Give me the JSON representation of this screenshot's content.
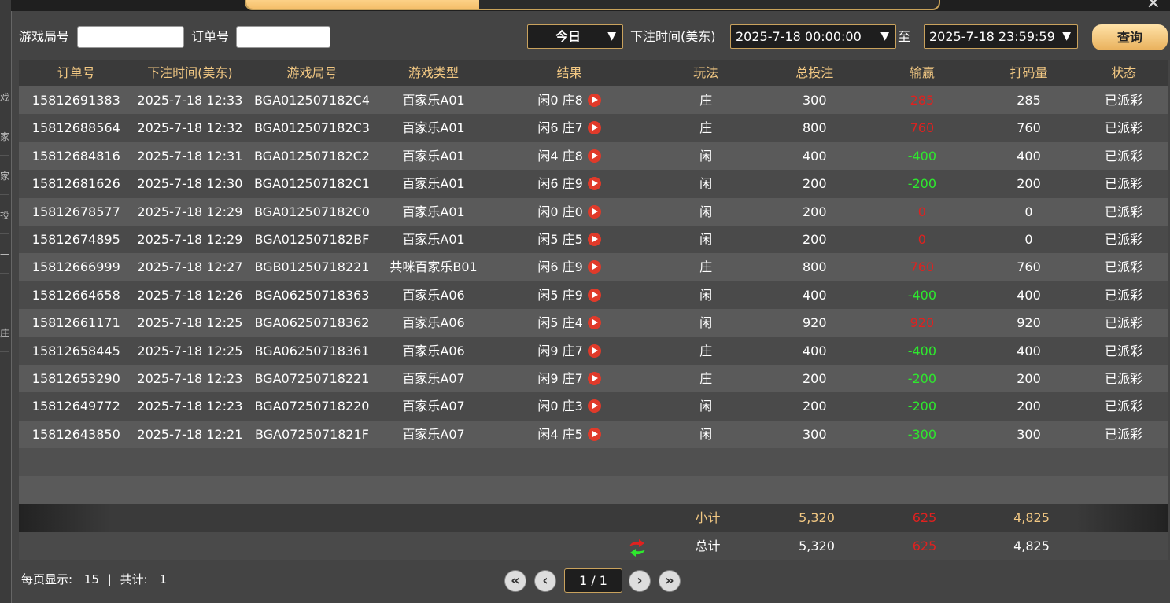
{
  "window": {
    "left_tabs": [
      "戏",
      "家乐",
      "家乐",
      "投宝",
      "一公",
      "庄"
    ],
    "close_label": "✕"
  },
  "filters": {
    "game_round_label": "游戏局号",
    "game_round_value": "",
    "order_no_label": "订单号",
    "order_no_value": "",
    "date_range_selected": "今日",
    "bet_time_label": "下注时间(美东)",
    "start_time": "2025-7-18 00:00:00",
    "to_label": "至",
    "end_time": "2025-7-18 23:59:59",
    "query_button": "查询"
  },
  "table": {
    "headers": [
      "订单号",
      "下注时间(美东)",
      "游戏局号",
      "游戏类型",
      "结果",
      "玩法",
      "总投注",
      "输赢",
      "打码量",
      "状态"
    ],
    "rows": [
      {
        "order": "15812691383",
        "time": "2025-7-18 12:33",
        "round": "BGA012507182C4",
        "game": "百家乐A01",
        "result": "闲0 庄8",
        "play": "庄",
        "bet": "300",
        "winloss": "285",
        "wl_color": "red",
        "code": "285",
        "status": "已派彩"
      },
      {
        "order": "15812688564",
        "time": "2025-7-18 12:32",
        "round": "BGA012507182C3",
        "game": "百家乐A01",
        "result": "闲6 庄7",
        "play": "庄",
        "bet": "800",
        "winloss": "760",
        "wl_color": "red",
        "code": "760",
        "status": "已派彩"
      },
      {
        "order": "15812684816",
        "time": "2025-7-18 12:31",
        "round": "BGA012507182C2",
        "game": "百家乐A01",
        "result": "闲4 庄8",
        "play": "闲",
        "bet": "400",
        "winloss": "-400",
        "wl_color": "green",
        "code": "400",
        "status": "已派彩"
      },
      {
        "order": "15812681626",
        "time": "2025-7-18 12:30",
        "round": "BGA012507182C1",
        "game": "百家乐A01",
        "result": "闲6 庄9",
        "play": "闲",
        "bet": "200",
        "winloss": "-200",
        "wl_color": "green",
        "code": "200",
        "status": "已派彩"
      },
      {
        "order": "15812678577",
        "time": "2025-7-18 12:29",
        "round": "BGA012507182C0",
        "game": "百家乐A01",
        "result": "闲0 庄0",
        "play": "闲",
        "bet": "200",
        "winloss": "0",
        "wl_color": "red",
        "code": "0",
        "status": "已派彩"
      },
      {
        "order": "15812674895",
        "time": "2025-7-18 12:29",
        "round": "BGA012507182BF",
        "game": "百家乐A01",
        "result": "闲5 庄5",
        "play": "闲",
        "bet": "200",
        "winloss": "0",
        "wl_color": "red",
        "code": "0",
        "status": "已派彩"
      },
      {
        "order": "15812666999",
        "time": "2025-7-18 12:27",
        "round": "BGB01250718221",
        "game": "共咪百家乐B01",
        "result": "闲6 庄9",
        "play": "庄",
        "bet": "800",
        "winloss": "760",
        "wl_color": "red",
        "code": "760",
        "status": "已派彩"
      },
      {
        "order": "15812664658",
        "time": "2025-7-18 12:26",
        "round": "BGA06250718363",
        "game": "百家乐A06",
        "result": "闲5 庄9",
        "play": "闲",
        "bet": "400",
        "winloss": "-400",
        "wl_color": "green",
        "code": "400",
        "status": "已派彩"
      },
      {
        "order": "15812661171",
        "time": "2025-7-18 12:25",
        "round": "BGA06250718362",
        "game": "百家乐A06",
        "result": "闲5 庄4",
        "play": "闲",
        "bet": "920",
        "winloss": "920",
        "wl_color": "red",
        "code": "920",
        "status": "已派彩"
      },
      {
        "order": "15812658445",
        "time": "2025-7-18 12:25",
        "round": "BGA06250718361",
        "game": "百家乐A06",
        "result": "闲9 庄7",
        "play": "庄",
        "bet": "400",
        "winloss": "-400",
        "wl_color": "green",
        "code": "400",
        "status": "已派彩"
      },
      {
        "order": "15812653290",
        "time": "2025-7-18 12:23",
        "round": "BGA07250718221",
        "game": "百家乐A07",
        "result": "闲9 庄7",
        "play": "庄",
        "bet": "200",
        "winloss": "-200",
        "wl_color": "green",
        "code": "200",
        "status": "已派彩"
      },
      {
        "order": "15812649772",
        "time": "2025-7-18 12:23",
        "round": "BGA07250718220",
        "game": "百家乐A07",
        "result": "闲0 庄3",
        "play": "闲",
        "bet": "200",
        "winloss": "-200",
        "wl_color": "green",
        "code": "200",
        "status": "已派彩"
      },
      {
        "order": "15812643850",
        "time": "2025-7-18 12:21",
        "round": "BGA0725071821F",
        "game": "百家乐A07",
        "result": "闲4 庄5",
        "play": "闲",
        "bet": "300",
        "winloss": "-300",
        "wl_color": "green",
        "code": "300",
        "status": "已派彩"
      }
    ],
    "subtotal": {
      "label": "小计",
      "bet": "5,320",
      "winloss": "625",
      "code": "4,825"
    },
    "total": {
      "label": "总计",
      "bet": "5,320",
      "winloss": "625",
      "code": "4,825"
    }
  },
  "footer": {
    "per_page_label": "每页显示:",
    "per_page_value": "15",
    "separator": "|",
    "total_label": "共计:",
    "total_value": "1",
    "page_display": "1 / 1"
  },
  "colors": {
    "accent": "#f2c883",
    "win": "#e0211f",
    "loss": "#2ee82e"
  }
}
